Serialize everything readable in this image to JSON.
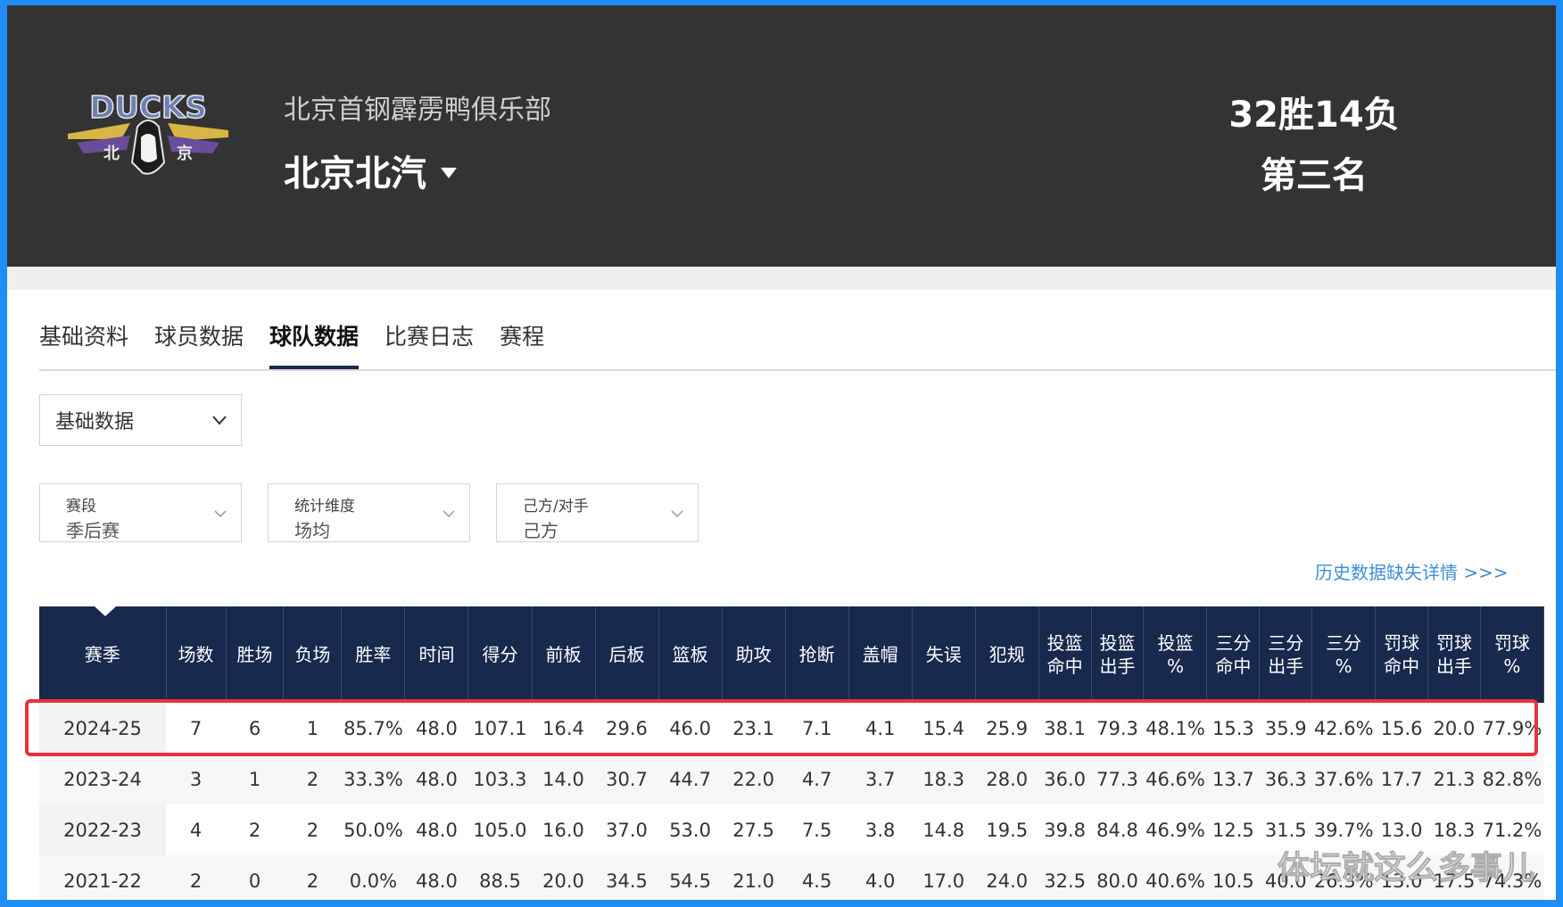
{
  "header": {
    "club_name": "北京首钢霹雳鸭俱乐部",
    "team_name": "北京北汽",
    "record": "32胜14负",
    "rank": "第三名",
    "logo_icon": "ducks-logo-icon"
  },
  "tabs": [
    {
      "label": "基础资料",
      "active": false
    },
    {
      "label": "球员数据",
      "active": false
    },
    {
      "label": "球队数据",
      "active": true
    },
    {
      "label": "比赛日志",
      "active": false
    },
    {
      "label": "赛程",
      "active": false
    }
  ],
  "stats_type": {
    "value": "基础数据"
  },
  "filters": [
    {
      "label": "赛段",
      "value": "季后赛"
    },
    {
      "label": "统计维度",
      "value": "场均"
    },
    {
      "label": "己方/对手",
      "value": "己方"
    }
  ],
  "history_link": "历史数据缺失详情 >>>",
  "table": {
    "headers": [
      "赛季",
      "场数",
      "胜场",
      "负场",
      "胜率",
      "时间",
      "得分",
      "前板",
      "后板",
      "篮板",
      "助攻",
      "抢断",
      "盖帽",
      "失误",
      "犯规",
      "投篮\n命中",
      "投篮\n出手",
      "投篮\n%",
      "三分\n命中",
      "三分\n出手",
      "三分\n%",
      "罚球\n命中",
      "罚球\n出手",
      "罚球\n%"
    ],
    "rows": [
      [
        "2024-25",
        "7",
        "6",
        "1",
        "85.7%",
        "48.0",
        "107.1",
        "16.4",
        "29.6",
        "46.0",
        "23.1",
        "7.1",
        "4.1",
        "15.4",
        "25.9",
        "38.1",
        "79.3",
        "48.1%",
        "15.3",
        "35.9",
        "42.6%",
        "15.6",
        "20.0",
        "77.9%"
      ],
      [
        "2023-24",
        "3",
        "1",
        "2",
        "33.3%",
        "48.0",
        "103.3",
        "14.0",
        "30.7",
        "44.7",
        "22.0",
        "4.7",
        "3.7",
        "18.3",
        "28.0",
        "36.0",
        "77.3",
        "46.6%",
        "13.7",
        "36.3",
        "37.6%",
        "17.7",
        "21.3",
        "82.8%"
      ],
      [
        "2022-23",
        "4",
        "2",
        "2",
        "50.0%",
        "48.0",
        "105.0",
        "16.0",
        "37.0",
        "53.0",
        "27.5",
        "7.5",
        "3.8",
        "14.8",
        "19.5",
        "39.8",
        "84.8",
        "46.9%",
        "12.5",
        "31.5",
        "39.7%",
        "13.0",
        "18.3",
        "71.2%"
      ],
      [
        "2021-22",
        "2",
        "0",
        "2",
        "0.0%",
        "48.0",
        "88.5",
        "20.0",
        "34.5",
        "54.5",
        "21.0",
        "4.5",
        "4.0",
        "17.0",
        "24.0",
        "32.5",
        "80.0",
        "40.6%",
        "10.5",
        "40.0",
        "26.3%",
        "13.0",
        "17.5",
        "74.3%"
      ]
    ],
    "highlighted_row": "2024-25"
  },
  "watermark": "体坛就这么多事儿",
  "colors": {
    "header_bg": "#333333",
    "table_header_bg": "#17294d",
    "highlight": "#e8323c",
    "link": "#3f8ed6",
    "frame": "#1e8df5"
  }
}
